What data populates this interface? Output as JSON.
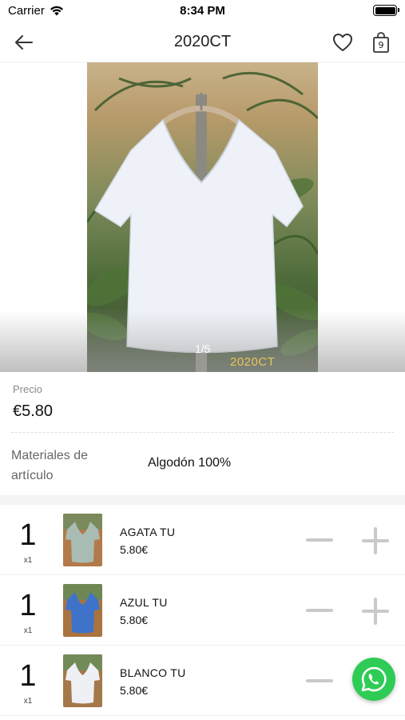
{
  "status_bar": {
    "carrier": "Carrier",
    "time": "8:34 PM",
    "battery_level": 1.0
  },
  "nav": {
    "title": "2020CT",
    "bag_count": "9",
    "icons": {
      "back": "back-arrow-icon",
      "favorite": "heart-icon",
      "bag": "shopping-bag-icon"
    }
  },
  "hero": {
    "counter": "1/5",
    "watermark": "2020CT"
  },
  "price": {
    "label": "Precio",
    "value": "€5.80"
  },
  "materials": {
    "label": "Materiales de artículo",
    "value": "Algodón 100%"
  },
  "variants": [
    {
      "qty": "1",
      "multiplier": "x1",
      "name": "AGATA TU",
      "price": "5.80€",
      "color": "#a9bcb4"
    },
    {
      "qty": "1",
      "multiplier": "x1",
      "name": "AZUL TU",
      "price": "5.80€",
      "color": "#3f73c9"
    },
    {
      "qty": "1",
      "multiplier": "x1",
      "name": "BLANCO TU",
      "price": "5.80€",
      "color": "#eef0f4"
    }
  ],
  "colors": {
    "accent_whatsapp": "#2ecc55",
    "stepper_gray": "#c9c9c9",
    "watermark_gold": "#e8c45a"
  }
}
